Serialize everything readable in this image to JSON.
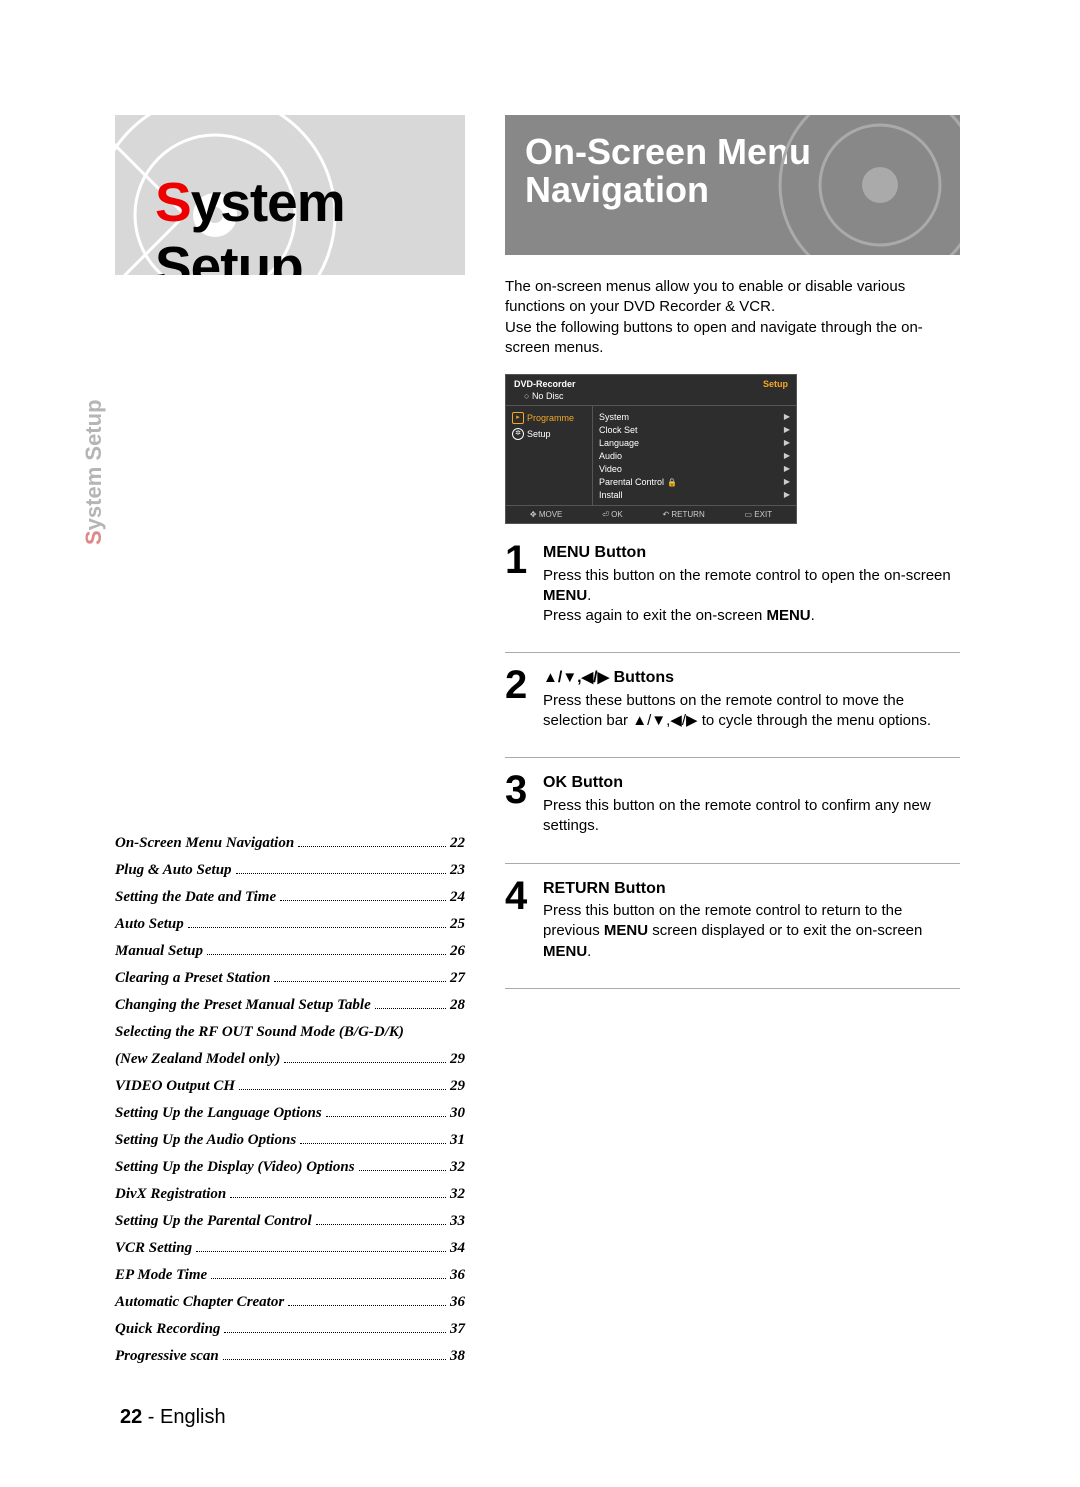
{
  "section_title_prefix": "S",
  "section_title_rest": "ystem Setup",
  "side_tab_prefix": "S",
  "side_tab_rest": "ystem Setup",
  "right_header_line1": "On-Screen Menu",
  "right_header_line2": "Navigation",
  "intro_p1": "The on-screen menus allow you to enable or disable various functions on your DVD Recorder & VCR.",
  "intro_p2": "Use the following buttons to open and navigate through the on-screen menus.",
  "osd": {
    "title_left": "DVD-Recorder",
    "title_right": "Setup",
    "no_disc": "No Disc",
    "left_items": [
      "Programme",
      "Setup"
    ],
    "right_items": [
      "System",
      "Clock Set",
      "Language",
      "Audio",
      "Video",
      "Parental Control",
      "Install"
    ],
    "parental_lock_icon": "🔒",
    "foot": {
      "move": "MOVE",
      "ok": "OK",
      "return": "RETURN",
      "exit": "EXIT"
    }
  },
  "steps": [
    {
      "num": "1",
      "title": "MENU Button",
      "body_html": "Press this button on the remote control to open the on-screen <b>MENU</b>.<br>Press again to exit the on-screen <b>MENU</b>."
    },
    {
      "num": "2",
      "title_html": "<span class='arrow-glyph'>▲</span>/<span class='arrow-glyph'>▼</span>,<span class='arrow-glyph'>◀</span>/<span class='arrow-glyph'>▶</span> Buttons",
      "body_html": "Press these buttons on the remote control to move the selection bar <span class='arrow-glyph'>▲</span>/<span class='arrow-glyph'>▼</span>,<span class='arrow-glyph'>◀</span>/<span class='arrow-glyph'>▶</span> to cycle through the menu options."
    },
    {
      "num": "3",
      "title": "OK Button",
      "body_html": "Press this button on the remote control to confirm any new settings."
    },
    {
      "num": "4",
      "title": "RETURN Button",
      "body_html": "Press this button on the remote control to return to the previous <b>MENU</b> screen displayed or to exit the on-screen <b>MENU</b>."
    }
  ],
  "toc": [
    {
      "label": "On-Screen Menu Navigation",
      "page": "22"
    },
    {
      "label": "Plug & Auto Setup",
      "page": "23"
    },
    {
      "label": "Setting the Date and Time",
      "page": "24"
    },
    {
      "label": "Auto Setup",
      "page": "25"
    },
    {
      "label": "Manual Setup",
      "page": "26"
    },
    {
      "label": "Clearing a Preset Station",
      "page": "27"
    },
    {
      "label": "Changing the Preset Manual Setup Table",
      "page": "28"
    },
    {
      "label": "Selecting the RF OUT Sound Mode (B/G-D/K)",
      "page": "",
      "nolead": true
    },
    {
      "label": "(New Zealand Model only)",
      "page": "29"
    },
    {
      "label": "VIDEO Output CH",
      "page": "29"
    },
    {
      "label": "Setting Up the Language Options",
      "page": "30"
    },
    {
      "label": "Setting Up the Audio Options",
      "page": "31"
    },
    {
      "label": "Setting Up the Display (Video) Options",
      "page": "32"
    },
    {
      "label": "DivX Registration",
      "page": "32"
    },
    {
      "label": "Setting Up the Parental Control",
      "page": "33"
    },
    {
      "label": "VCR Setting",
      "page": "34"
    },
    {
      "label": "EP Mode Time",
      "page": "36"
    },
    {
      "label": "Automatic Chapter Creator",
      "page": "36"
    },
    {
      "label": "Quick Recording",
      "page": "37"
    },
    {
      "label": "Progressive scan",
      "page": "38"
    }
  ],
  "footer": {
    "page_number": "22",
    "sep": " - ",
    "lang": "English"
  }
}
